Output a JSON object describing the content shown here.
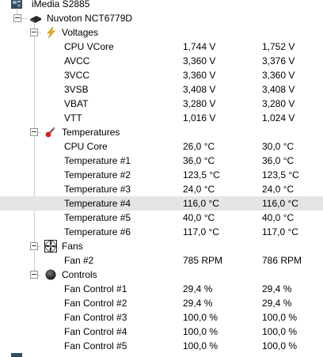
{
  "tree": {
    "board": {
      "label": "iMedia S2885",
      "icon": "motherboard-icon"
    },
    "chip": {
      "label": "Nuvoton NCT6779D",
      "icon": "chip-icon"
    },
    "voltages": {
      "label": "Voltages",
      "icon": "lightning-icon",
      "items": [
        {
          "name": "CPU VCore",
          "value": "1,744 V",
          "max": "1,752 V"
        },
        {
          "name": "AVCC",
          "value": "3,360 V",
          "max": "3,376 V"
        },
        {
          "name": "3VCC",
          "value": "3,360 V",
          "max": "3,360 V"
        },
        {
          "name": "3VSB",
          "value": "3,408 V",
          "max": "3,408 V"
        },
        {
          "name": "VBAT",
          "value": "3,280 V",
          "max": "3,280 V"
        },
        {
          "name": "VTT",
          "value": "1,016 V",
          "max": "1,024 V"
        }
      ]
    },
    "temperatures": {
      "label": "Temperatures",
      "icon": "thermometer-icon",
      "items": [
        {
          "name": "CPU Core",
          "value": "26,0 °C",
          "max": "30,0 °C"
        },
        {
          "name": "Temperature #1",
          "value": "36,0 °C",
          "max": "36,0 °C"
        },
        {
          "name": "Temperature #2",
          "value": "123,5 °C",
          "max": "123,5 °C"
        },
        {
          "name": "Temperature #3",
          "value": "24,0 °C",
          "max": "24,0 °C"
        },
        {
          "name": "Temperature #4",
          "value": "116,0 °C",
          "max": "116,0 °C"
        },
        {
          "name": "Temperature #5",
          "value": "40,0 °C",
          "max": "40,0 °C"
        },
        {
          "name": "Temperature #6",
          "value": "117,0 °C",
          "max": "117,0 °C"
        }
      ]
    },
    "fans": {
      "label": "Fans",
      "icon": "fan-icon",
      "items": [
        {
          "name": "Fan #2",
          "value": "785 RPM",
          "max": "786 RPM"
        }
      ]
    },
    "controls": {
      "label": "Controls",
      "icon": "control-knob-icon",
      "items": [
        {
          "name": "Fan Control #1",
          "value": "29,4 %",
          "max": "29,4 %"
        },
        {
          "name": "Fan Control #2",
          "value": "29,4 %",
          "max": "29,4 %"
        },
        {
          "name": "Fan Control #3",
          "value": "100,0 %",
          "max": "100,0 %"
        },
        {
          "name": "Fan Control #4",
          "value": "100,0 %",
          "max": "100,0 %"
        },
        {
          "name": "Fan Control #5",
          "value": "100,0 %",
          "max": "100,0 %"
        }
      ]
    }
  },
  "selected_row": "Temperature #4",
  "colors": {
    "selection": "#e5e5e5",
    "tree_lines": "#a0a0a0"
  }
}
